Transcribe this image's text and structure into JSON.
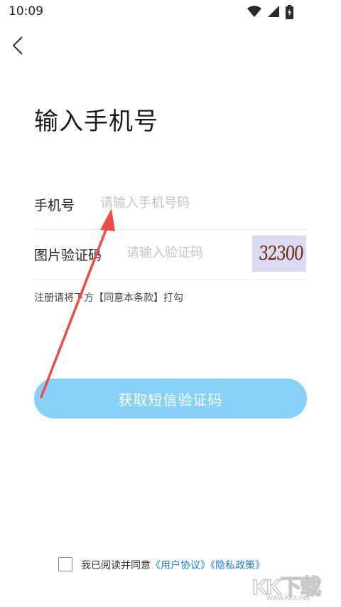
{
  "status_bar": {
    "time": "10:09"
  },
  "header": {
    "back_icon": "chevron-left-icon"
  },
  "title": "输入手机号",
  "phone_row": {
    "label": "手机号",
    "placeholder": "请输入手机号码"
  },
  "captcha_row": {
    "label": "图片验证码",
    "placeholder": "请输入验证码",
    "captcha_text": "32300"
  },
  "hint": "注册请将下方【同意本条款】打勾",
  "submit_button": "获取短信验证码",
  "agreement": {
    "prefix": "我已阅读并同意",
    "user_agreement": "《用户协议》",
    "privacy_policy": "《隐私政策》"
  },
  "watermark": {
    "logo": "KK下载",
    "url": "www.kkx.net"
  },
  "colors": {
    "button": "#87d0f7",
    "link": "#1e7ee0",
    "arrow": "#ee4b4b",
    "captcha_bg": "#dcdaf0"
  }
}
